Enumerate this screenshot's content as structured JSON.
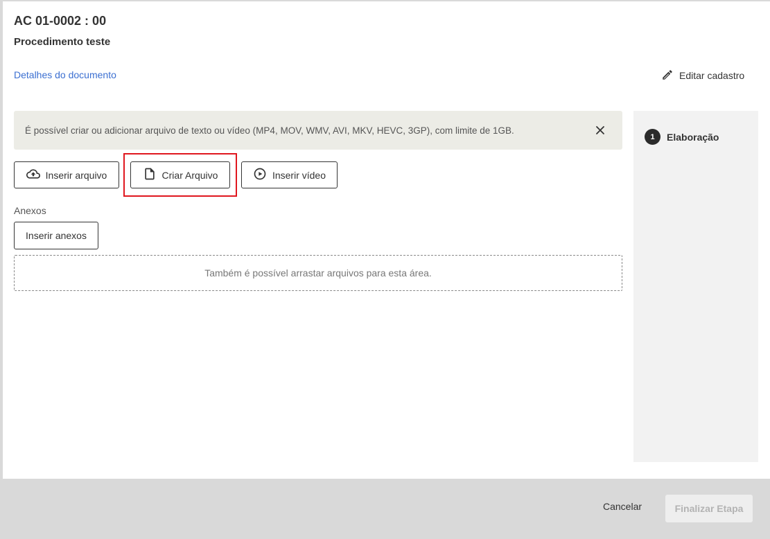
{
  "header": {
    "doc_code": "AC 01-0002 : 00",
    "doc_title": "Procedimento teste",
    "details_link": "Detalhes do documento",
    "edit_label": "Editar cadastro"
  },
  "banner": {
    "text": "É possível criar ou adicionar arquivo de texto ou vídeo (MP4, MOV, WMV, AVI, MKV, HEVC, 3GP), com limite de 1GB."
  },
  "actions": {
    "upload_label": "Inserir arquivo",
    "create_label": "Criar Arquivo",
    "video_label": "Inserir vídeo"
  },
  "attachments": {
    "section_label": "Anexos",
    "button_label": "Inserir anexos",
    "dropzone_text": "Também é possível arrastar arquivos para esta área."
  },
  "steps": [
    {
      "number": "1",
      "label": "Elaboração"
    }
  ],
  "footer": {
    "cancel_label": "Cancelar",
    "finish_label": "Finalizar Etapa"
  },
  "colors": {
    "link": "#3b6fd1",
    "highlight": "#e0161e",
    "banner_bg": "#ecece6"
  }
}
